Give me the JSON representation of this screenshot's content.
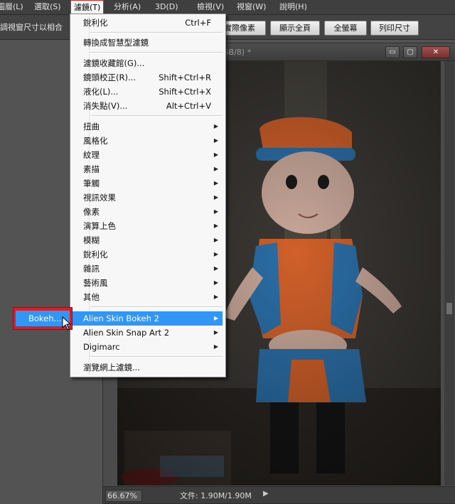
{
  "menubar": {
    "items": [
      {
        "label": "圖層(L)",
        "active": false
      },
      {
        "label": "選取(S)",
        "active": false
      },
      {
        "label": "濾鏡(T)",
        "active": true
      },
      {
        "label": "分析(A)",
        "active": false
      },
      {
        "label": "3D(D)",
        "active": false
      },
      {
        "label": "檢視(V)",
        "active": false
      },
      {
        "label": "視窗(W)",
        "active": false
      },
      {
        "label": "說明(H)",
        "active": false
      }
    ]
  },
  "optionsbar": {
    "checkbox_label": "調視窗尺寸以相合",
    "buttons": [
      "實際像素",
      "顯示全頁",
      "全螢幕",
      "列印尺寸"
    ]
  },
  "document": {
    "title_fragment": "GB/8) *",
    "window_buttons": [
      "▭",
      "▢",
      "✕"
    ],
    "zoom": "66.67%",
    "doc_info": "文件: 1.90M/1.90M",
    "status_arrow": "▶"
  },
  "filter_menu": {
    "items": [
      {
        "label": "銳利化",
        "shortcut": "Ctrl+F",
        "submenu": false
      },
      {
        "separator": true
      },
      {
        "label": "轉換成智慧型濾鏡",
        "submenu": false
      },
      {
        "separator": true
      },
      {
        "label": "濾鏡收藏館(G)...",
        "submenu": false
      },
      {
        "label": "鏡頭校正(R)...",
        "shortcut": "Shift+Ctrl+R",
        "submenu": false
      },
      {
        "label": "液化(L)...",
        "shortcut": "Shift+Ctrl+X",
        "submenu": false
      },
      {
        "label": "消失點(V)...",
        "shortcut": "Alt+Ctrl+V",
        "submenu": false
      },
      {
        "separator": true
      },
      {
        "label": "扭曲",
        "submenu": true
      },
      {
        "label": "風格化",
        "submenu": true
      },
      {
        "label": "紋理",
        "submenu": true
      },
      {
        "label": "素描",
        "submenu": true
      },
      {
        "label": "筆觸",
        "submenu": true
      },
      {
        "label": "視訊效果",
        "submenu": true
      },
      {
        "label": "像素",
        "submenu": true
      },
      {
        "label": "演算上色",
        "submenu": true
      },
      {
        "label": "模糊",
        "submenu": true
      },
      {
        "label": "銳利化",
        "submenu": true
      },
      {
        "label": "雜訊",
        "submenu": true
      },
      {
        "label": "藝術風",
        "submenu": true
      },
      {
        "label": "其他",
        "submenu": true
      },
      {
        "separator": true
      },
      {
        "label": "Alien Skin Bokeh 2",
        "submenu": true,
        "highlighted": true
      },
      {
        "label": "Alien Skin Snap Art 2",
        "submenu": true
      },
      {
        "label": "Digimarc",
        "submenu": true
      },
      {
        "separator": true
      },
      {
        "label": "瀏覽網上濾鏡...",
        "submenu": false
      }
    ],
    "arrow": "▶"
  },
  "submenu": {
    "label": "Bokeh..."
  },
  "colors": {
    "highlight": "#3196f5",
    "annotation_red": "#d61f26",
    "doll_orange": "#e0662a",
    "doll_blue": "#2e7fc0"
  }
}
